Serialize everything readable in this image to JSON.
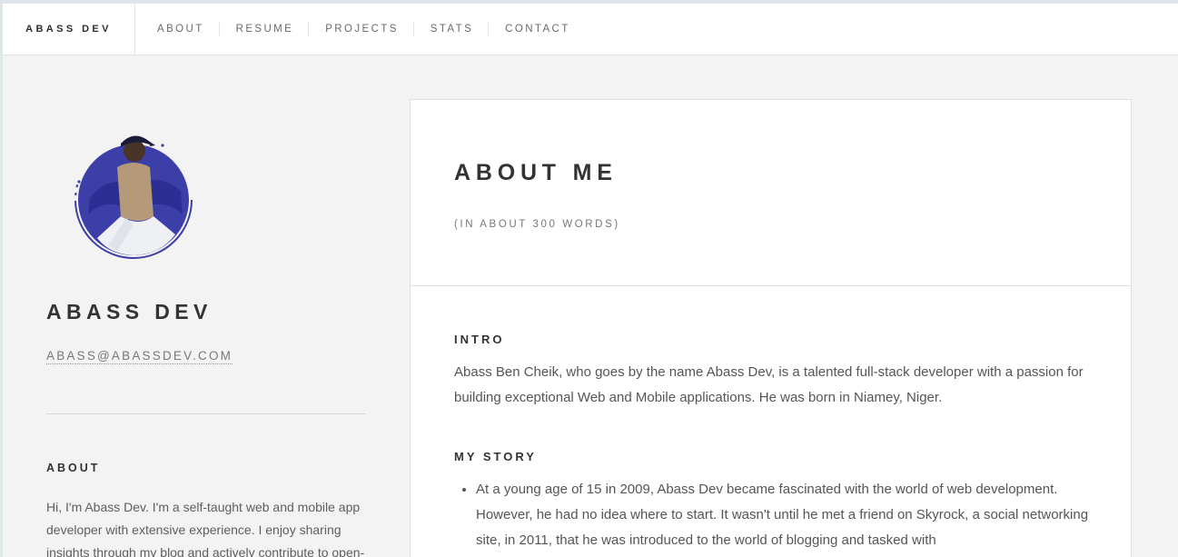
{
  "nav": {
    "brand": "ABASS DEV",
    "links": [
      "ABOUT",
      "RESUME",
      "PROJECTS",
      "STATS",
      "CONTACT"
    ]
  },
  "sidebar": {
    "name": "ABASS DEV",
    "email": "ABASS@ABASSDEV.COM",
    "about_heading": "ABOUT",
    "about_text": "Hi, I'm Abass Dev. I'm a self-taught web and mobile app developer with extensive experience. I enjoy sharing insights through my blog and actively contribute to open-"
  },
  "main": {
    "title": "ABOUT ME",
    "subtitle": "(IN ABOUT 300 WORDS)",
    "intro_heading": "INTRO",
    "intro_text": "Abass Ben Cheik, who goes by the name Abass Dev, is a talented full-stack developer with a passion for building exceptional Web and Mobile applications. He was born in Niamey, Niger.",
    "story_heading": "MY STORY",
    "story_items": [
      "At a young age of 15 in 2009, Abass Dev became fascinated with the world of web development. However, he had no idea where to start. It wasn't until he met a friend on Skyrock, a social networking site, in 2011, that he was introduced to the world of blogging and tasked with"
    ]
  },
  "colors": {
    "page_bg": "#f3f3f3",
    "nav_bg": "#ffffff",
    "avatar_ring": "#3d3fa8",
    "text_dark": "#333333"
  }
}
